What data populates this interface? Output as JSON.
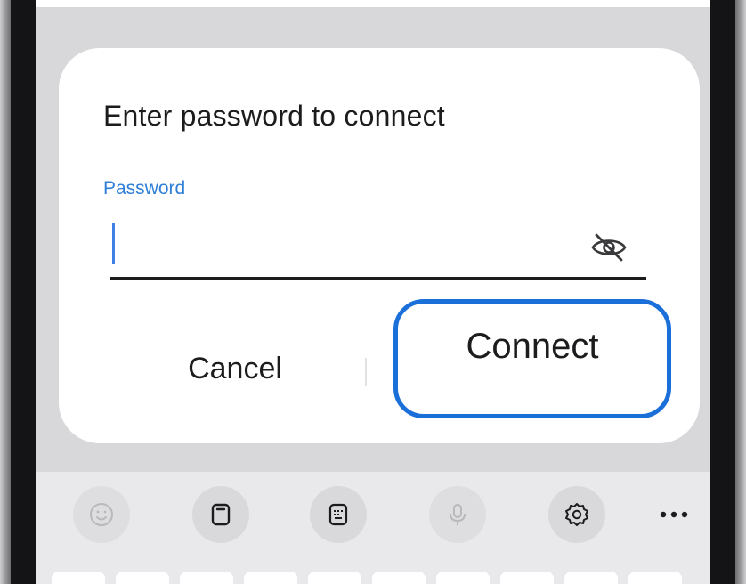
{
  "dialog": {
    "title": "Enter password to connect",
    "field_label": "Password",
    "password_value": "",
    "cancel_label": "Cancel",
    "connect_label": "Connect"
  },
  "toolbar": {
    "items": [
      {
        "icon": "emoji-icon",
        "enabled": false
      },
      {
        "icon": "clipboard-icon",
        "enabled": true
      },
      {
        "icon": "keyboard-mode-icon",
        "enabled": true
      },
      {
        "icon": "microphone-icon",
        "enabled": false
      },
      {
        "icon": "gear-icon",
        "enabled": true
      },
      {
        "icon": "more-options-icon",
        "enabled": true
      }
    ]
  },
  "colors": {
    "accent": "#1a6fd9",
    "label_blue": "#2f7fd8",
    "text": "#1c1c1e",
    "dialog_background": "#ffffff",
    "screen_dim": "#d8d8da",
    "keyboard_background": "#e9e9eb"
  }
}
